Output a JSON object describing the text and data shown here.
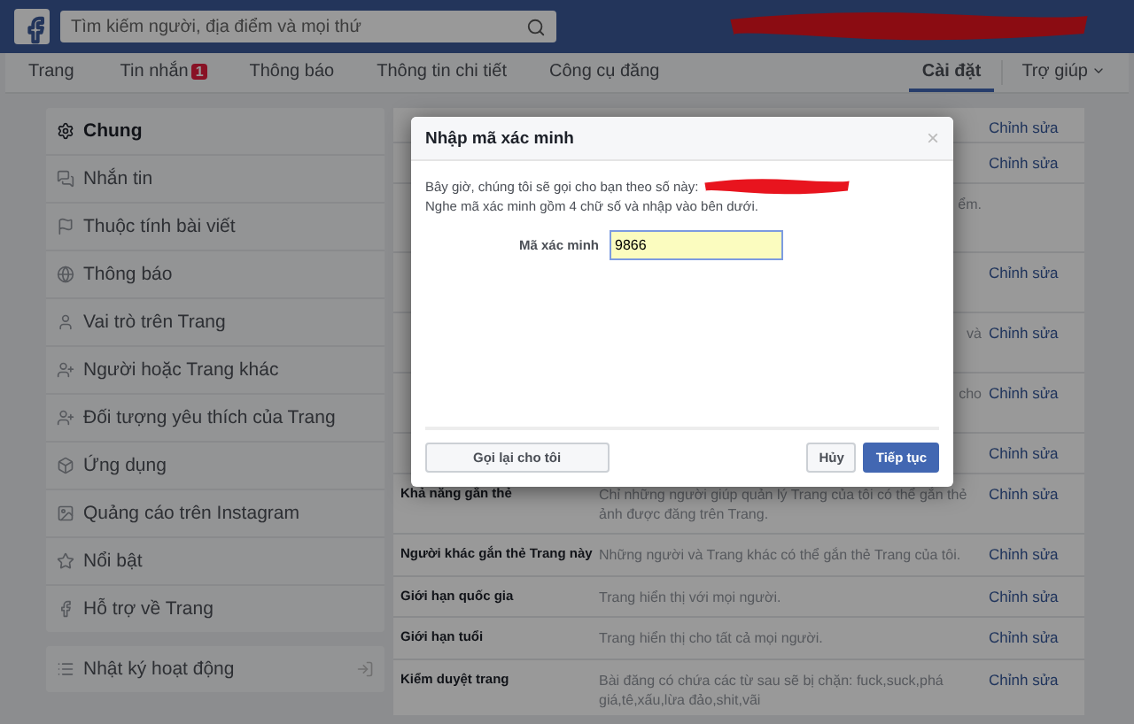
{
  "topbar": {
    "search": {
      "placeholder": "Tìm kiếm người, địa điểm và mọi thứ"
    }
  },
  "nav": {
    "tabs": [
      {
        "label": "Trang",
        "selected": false
      },
      {
        "label": "Tin nhắn",
        "badge": "1",
        "selected": false
      },
      {
        "label": "Thông báo",
        "selected": false
      },
      {
        "label": "Thông tin chi tiết",
        "selected": false
      },
      {
        "label": "Công cụ đăng",
        "selected": false
      }
    ],
    "right_tabs": [
      {
        "label": "Cài đặt",
        "selected": true
      },
      {
        "label": "Trợ giúp",
        "selected": false
      }
    ]
  },
  "sidebar": {
    "items": [
      {
        "label": "Chung",
        "selected": true
      },
      {
        "label": "Nhắn tin",
        "selected": false
      },
      {
        "label": "Thuộc tính bài viết",
        "selected": false
      },
      {
        "label": "Thông báo",
        "selected": false
      },
      {
        "label": "Vai trò trên Trang",
        "selected": false
      },
      {
        "label": "Người hoặc Trang khác",
        "selected": false
      },
      {
        "label": "Đối tượng yêu thích của Trang",
        "selected": false
      },
      {
        "label": "Ứng dụng",
        "selected": false
      },
      {
        "label": "Quảng cáo trên Instagram",
        "selected": false
      },
      {
        "label": "Nổi bật",
        "selected": false
      },
      {
        "label": "Hỗ trợ về Trang",
        "selected": false
      }
    ],
    "activity_log": {
      "label": "Nhật ký hoạt động"
    }
  },
  "settings": {
    "rows": [
      {
        "edit": "Chỉnh sửa"
      },
      {
        "edit": "Chỉnh sửa"
      },
      {
        "description": "ểm."
      },
      {
        "edit": "Chỉnh sửa"
      },
      {
        "description": "và",
        "edit": "Chỉnh sửa"
      },
      {
        "description": "cho",
        "edit": "Chỉnh sửa"
      },
      {
        "edit": "Chỉnh sửa"
      },
      {
        "label": "Khả năng gắn thẻ",
        "description": "Chỉ những người giúp quản lý Trang của tôi có thể gắn thẻ ảnh được đăng trên Trang.",
        "edit": "Chỉnh sửa"
      },
      {
        "label": "Người khác gắn thẻ Trang này",
        "description": "Những người và Trang khác có thể gắn thẻ Trang của tôi.",
        "edit": "Chỉnh sửa"
      },
      {
        "label": "Giới hạn quốc gia",
        "description": "Trang hiển thị với mọi người.",
        "edit": "Chỉnh sửa"
      },
      {
        "label": "Giới hạn tuổi",
        "description": "Trang hiển thị cho tất cả mọi người.",
        "edit": "Chỉnh sửa"
      },
      {
        "label": "Kiểm duyệt trang",
        "description": "Bài đăng có chứa các từ sau sẽ bị chặn: fuck,suck,phá giá,tê,xấu,lừa đảo,shit,vãi",
        "edit": "Chỉnh sửa"
      }
    ]
  },
  "dialog": {
    "title": "Nhập mã xác minh",
    "close": "×",
    "lines": [
      "Bây giờ, chúng tôi sẽ gọi cho bạn theo số này:",
      "Nghe mã xác minh gồm 4 chữ số và nhập vào bên dưới."
    ],
    "field": {
      "label": "Mã xác minh",
      "value": "9866"
    },
    "buttons": [
      {
        "label": "Gọi lại cho tôi",
        "kind": "secondary"
      },
      {
        "label": "Hủy",
        "kind": "secondary"
      },
      {
        "label": "Tiếp tục",
        "kind": "primary"
      }
    ]
  }
}
